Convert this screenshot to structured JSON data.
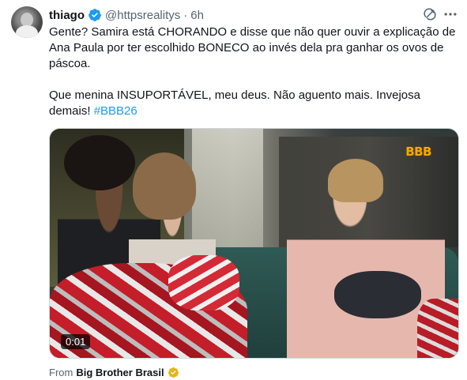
{
  "tweet": {
    "author_name": "thiago",
    "author_handle": "@httpsrealitys",
    "separator": "·",
    "time": "6h",
    "text_line1": "Gente? Samira está CHORANDO e disse que não quer ouvir a explicação de Ana Paula por ter escolhido BONECO ao invés dela pra ganhar os ovos de páscoa.",
    "text_line2": "Que menina INSUPORTÁVEL, meu deus. Não aguento mais. Invejosa demais! ",
    "hashtag": "#BBB26",
    "media": {
      "overlay_logo": "BBB",
      "duration": "0:01"
    },
    "source_prefix": "From",
    "source_name": "Big Brother Brasil"
  },
  "icons": {
    "verified": "verified-badge-icon",
    "grok": "grok-icon",
    "more": "more-options-icon",
    "gold_verified": "gold-verified-badge-icon"
  },
  "colors": {
    "text": "#0f1419",
    "secondary": "#536471",
    "link": "#1d9bf0",
    "verified_blue": "#1d9bf0",
    "verified_gold": "#e2b719"
  }
}
